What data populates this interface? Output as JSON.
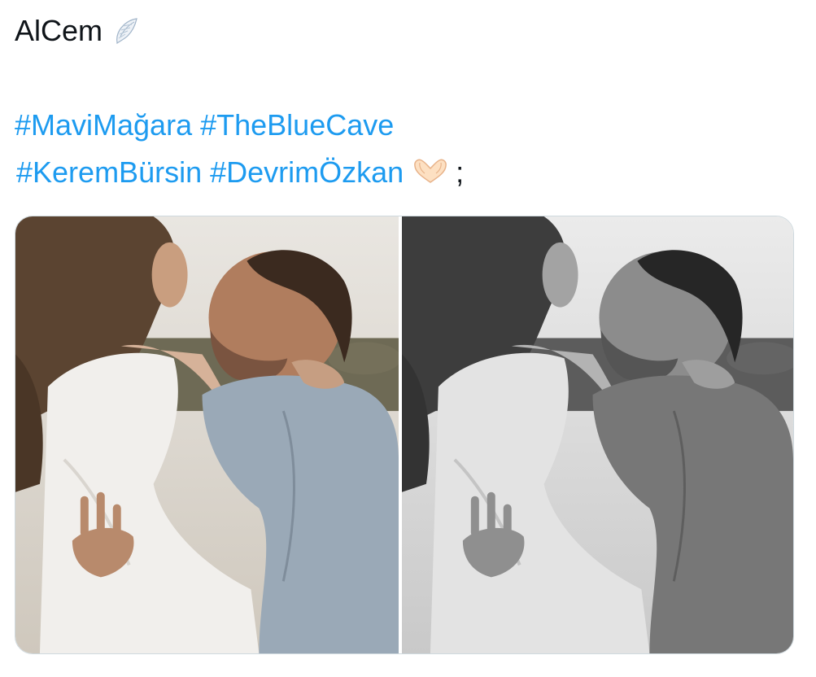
{
  "tweet": {
    "author_line": "AlCem",
    "wing_icon": "wing-emoji-icon",
    "hashtags_line1": [
      "#MaviMağara",
      "#TheBlueCave"
    ],
    "hashtags_line2": [
      "#KeremBürsin",
      "#DevrimÖzkan"
    ],
    "heart_icon": "heart-hands-emoji-icon",
    "trailing_punct": ";"
  },
  "media": {
    "photos": [
      {
        "name": "photo-color",
        "style": "color"
      },
      {
        "name": "photo-grayscale",
        "style": "grayscale"
      }
    ]
  },
  "colors": {
    "text": "#0f1419",
    "link": "#1d9bf0",
    "border": "#cfd9de"
  }
}
